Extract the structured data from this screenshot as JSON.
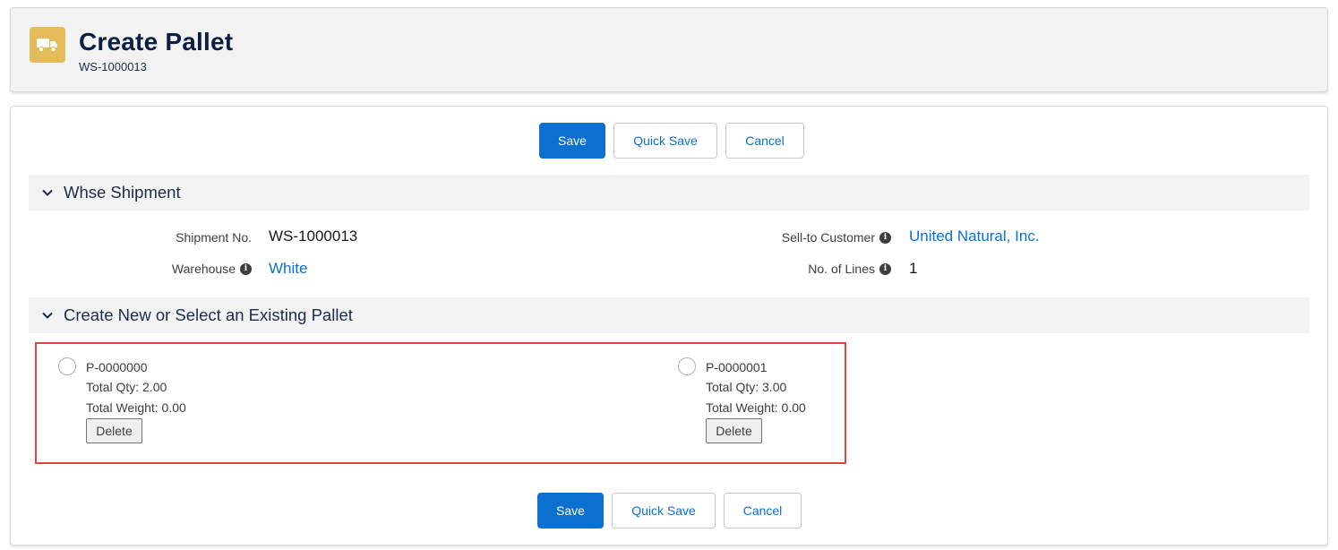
{
  "header": {
    "icon": "truck-icon",
    "title": "Create Pallet",
    "subtitle": "WS-1000013",
    "icon_color": "#e3bb58"
  },
  "toolbar_top": {
    "save_label": "Save",
    "quick_save_label": "Quick Save",
    "cancel_label": "Cancel"
  },
  "section_shipment": {
    "title": "Whse Shipment",
    "fields": {
      "shipment_no_label": "Shipment No.",
      "shipment_no_value": "WS-1000013",
      "warehouse_label": "Warehouse",
      "warehouse_value": "White",
      "sell_to_label": "Sell-to Customer",
      "sell_to_value": "United Natural, Inc.",
      "lines_label": "No. of Lines",
      "lines_value": "1"
    }
  },
  "section_pallet": {
    "title": "Create New or Select an Existing Pallet",
    "pallets": [
      {
        "id": "P-0000000",
        "qty": "Total Qty: 2.00",
        "weight": "Total Weight: 0.00",
        "delete_label": "Delete"
      },
      {
        "id": "P-0000001",
        "qty": "Total Qty: 3.00",
        "weight": "Total Weight: 0.00",
        "delete_label": "Delete"
      }
    ]
  },
  "toolbar_bottom": {
    "save_label": "Save",
    "quick_save_label": "Quick Save",
    "cancel_label": "Cancel"
  },
  "colors": {
    "brand": "#0b70d0",
    "highlight": "#e0443e",
    "title": "#0b1f44"
  }
}
